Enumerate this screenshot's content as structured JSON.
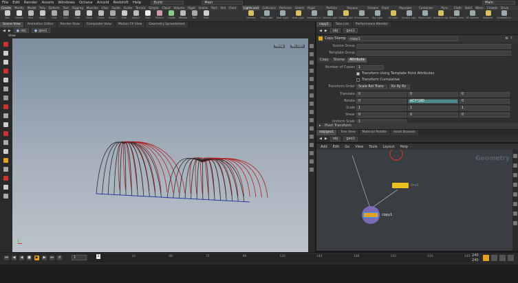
{
  "menubar": {
    "items": [
      "File",
      "Edit",
      "Render",
      "Assets",
      "Windows",
      "Octane",
      "Arnold",
      "Redshift",
      "Help"
    ],
    "build_label": "Build",
    "main_label": "Main",
    "right_main_label": "Main"
  },
  "shelf": {
    "left_tabs": [
      "Create",
      "Modify",
      "Model",
      "Poly",
      "Deform",
      "Text",
      "Rigging",
      "Muscles",
      "Char",
      "Guide",
      "Guide B",
      "Terrain",
      "Simple",
      "Cloud",
      "Volume",
      "Rigid",
      "Grains",
      "Part",
      "Vell",
      "Fluid",
      "Pyro"
    ],
    "left_tools": [
      "Box",
      "Sphere",
      "Tube",
      "Torus",
      "Grid",
      "Null",
      "Line",
      "Circle",
      "Curve",
      "Draw Curve",
      "Path",
      "Spray Paint",
      "Font",
      "Platonic Solids",
      "L-System",
      "Metaball",
      "File",
      "Tube"
    ],
    "right_tabs": [
      "Lights and C",
      "Collisions",
      "Particles",
      "Grains",
      "Rigid Bodies",
      "Particle Fluids",
      "Viscous Fluids",
      "Oceans",
      "Fluid Conta",
      "Populate Con",
      "Container Tools",
      "Pyro FX",
      "Cloth",
      "Solid",
      "Wires",
      "Crowds",
      "Drive Simula"
    ],
    "right_tools": [
      "Camera",
      "Point Light",
      "Spot Light",
      "Area Light",
      "Geometry Light",
      "Volume Light",
      "Distant Light",
      "Environment Light",
      "Sky Light",
      "GI Light",
      "Caustic Light",
      "Portal Light",
      "Ambient Light",
      "Stereo Camera",
      "VR Camera",
      "Switcher",
      "Gamepad Camera"
    ]
  },
  "left_pane": {
    "tabs": [
      "Scene View",
      "Animation Editor",
      "Render View",
      "Composite View",
      "Motion FX View",
      "Geometry Spreadsheet"
    ],
    "path_obj": "obj",
    "path_geo": "geo1",
    "view_label": "View",
    "persp_label": "Persp",
    "cam_label": "No cam"
  },
  "param_pane": {
    "tabs": [
      "copy1",
      "Take List",
      "Performance Monitor"
    ],
    "path_obj": "obj",
    "path_geo": "geo1",
    "node_type": "Copy Stamp",
    "node_name": "copy1",
    "source_group_label": "Source Group",
    "template_group_label": "Template Group",
    "sub_tabs": [
      "Copy",
      "Stamp",
      "Attribute"
    ],
    "num_copies_label": "Number of Copies",
    "num_copies_value": "1",
    "transform_using_label": "Transform Using Template Point Attributes",
    "transform_cumulative_label": "Transform Cumulative",
    "transform_order_label": "Transform Order",
    "transform_order_value": "Scale Rot Trans",
    "rot_order_value": "Rx Ry Rz",
    "rows": [
      {
        "label": "Translate",
        "values": [
          "0",
          "0",
          "0"
        ]
      },
      {
        "label": "Rotate",
        "values": [
          "0",
          "$CY*180",
          "0"
        ]
      },
      {
        "label": "Scale",
        "values": [
          "1",
          "1",
          "1"
        ]
      },
      {
        "label": "Shear",
        "values": [
          "0",
          "0",
          "0"
        ]
      },
      {
        "label": "Uniform Scale",
        "values": [
          "1"
        ]
      }
    ],
    "pivot_label": "Pivot Transform"
  },
  "net_pane": {
    "tabs": [
      "/obj/geo1",
      "Tree View",
      "Material Palette",
      "Asset Browser"
    ],
    "path_obj": "obj",
    "path_geo": "geo1",
    "menu": [
      "Add",
      "Edit",
      "Go",
      "View",
      "Tools",
      "Layout",
      "Help"
    ],
    "watermark": "Geometry",
    "node_top_label": "",
    "node_mid_label": "line1",
    "node_copy_label": "copy1"
  },
  "timeline": {
    "ticks": [
      "1",
      "24",
      "48",
      "72",
      "96",
      "120",
      "144",
      "168",
      "192",
      "216",
      "240"
    ],
    "start_frame": "1",
    "current_frame": "1",
    "end_frame_a": "240",
    "end_frame_b": "240"
  },
  "colors": {
    "accent_orange": "#e8a020",
    "rotate_highlight": "#4a8a8a",
    "curve_red": "#b02020",
    "curve_black": "#2a2a2a",
    "base_blue": "#2a3ab0"
  }
}
